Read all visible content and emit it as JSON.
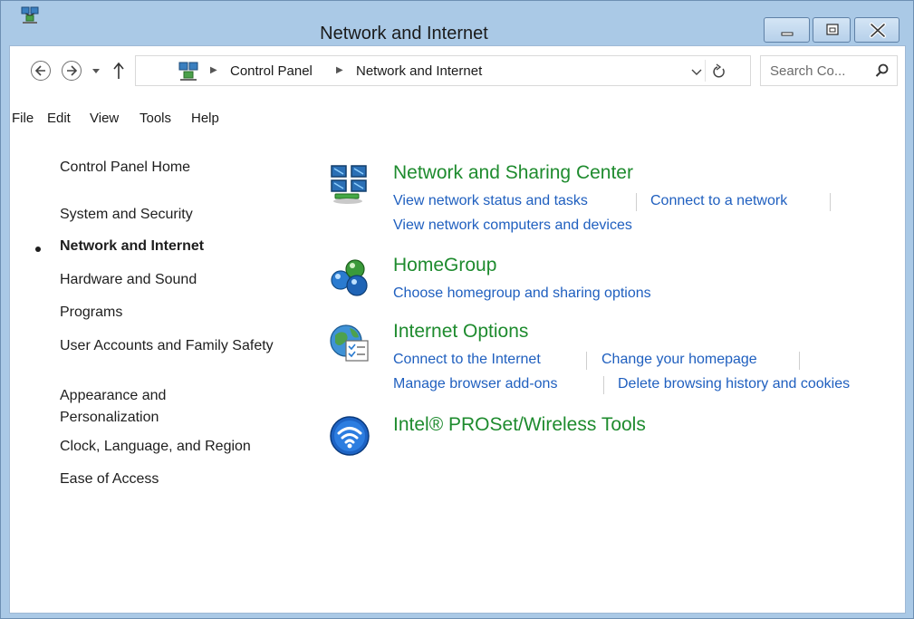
{
  "window": {
    "title": "Network and Internet"
  },
  "address": {
    "crumbs": [
      "Control Panel",
      "Network and Internet"
    ]
  },
  "search": {
    "placeholder": "Search Co..."
  },
  "menu": [
    "File",
    "Edit",
    "View",
    "Tools",
    "Help"
  ],
  "leftnav": {
    "home": "Control Panel Home",
    "items": [
      {
        "label": "System and Security",
        "current": false
      },
      {
        "label": "Network and Internet",
        "current": true
      },
      {
        "label": "Hardware and Sound",
        "current": false
      },
      {
        "label": "Programs",
        "current": false
      },
      {
        "label": "User Accounts and Family Safety",
        "current": false
      },
      {
        "label": "Appearance and Personalization",
        "current": false
      },
      {
        "label": "Clock, Language, and Region",
        "current": false
      },
      {
        "label": "Ease of Access",
        "current": false
      }
    ]
  },
  "categories": [
    {
      "title": "Network and Sharing Center",
      "icon": "network-sharing-center-icon",
      "tasks": [
        "View network status and tasks",
        "Connect to a network",
        "View network computers and devices"
      ]
    },
    {
      "title": "HomeGroup",
      "icon": "homegroup-icon",
      "tasks": [
        "Choose homegroup and sharing options"
      ]
    },
    {
      "title": "Internet Options",
      "icon": "internet-options-icon",
      "tasks": [
        "Connect to the Internet",
        "Change your homepage",
        "Manage browser add-ons",
        "Delete browsing history and cookies"
      ]
    },
    {
      "title": "Intel® PROSet/Wireless Tools",
      "icon": "intel-wireless-icon",
      "tasks": []
    }
  ],
  "colors": {
    "frame": "#aac9e6",
    "category_title": "#1e8b2e",
    "task_link": "#1f5fbf"
  }
}
